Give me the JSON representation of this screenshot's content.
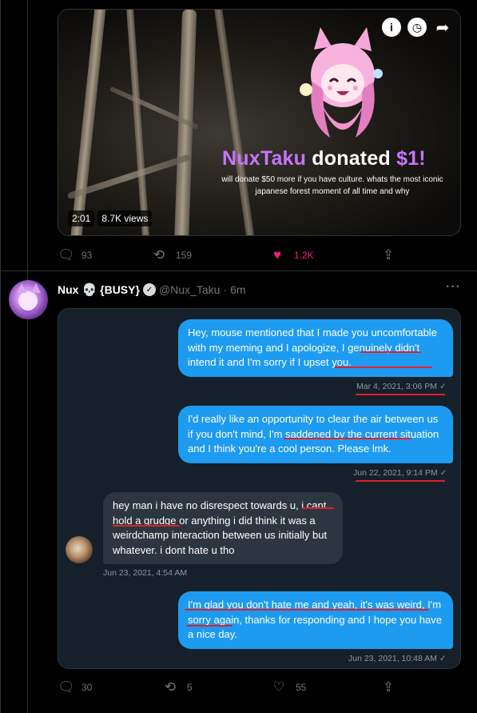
{
  "video": {
    "donation_name": "NuxTaku",
    "donation_word": "donated",
    "donation_amount": "$1!",
    "donation_message": "will donate $50 more if you have culture. whats the most iconic japanese forest moment of all time and why",
    "duration": "2:01",
    "views": "8.7K views",
    "icons": [
      "info-icon",
      "clock-icon",
      "share-arrow-icon"
    ]
  },
  "tweet1_actions": {
    "replies": "93",
    "retweets": "159",
    "likes": "1.2K",
    "like_color": "#f91880"
  },
  "tweet2": {
    "name": "Nux",
    "emoji": "💀",
    "busy": "{BUSY}",
    "handle": "@Nux_Taku",
    "dot": "·",
    "time": "6m",
    "more": "···"
  },
  "chat": {
    "messages": [
      {
        "direction": "out",
        "text": "Hey, mouse mentioned that I made you uncomfortable with my meming and I apologize, I genuinely didn't intend it and I'm sorry if I upset you.",
        "timestamp": "Mar 4, 2021, 3:06 PM"
      },
      {
        "direction": "out",
        "text": "I'd really like an opportunity to clear the air between us if you don't mind, I'm saddened by the current situation and I think you're a cool person. Please lmk.",
        "timestamp": "Jun 22, 2021, 9:14 PM"
      },
      {
        "direction": "in",
        "text": "hey man i have no disrespect towards u, i cant hold a grudge or anything i did think it was a weirdchamp interaction between us initially but whatever. i dont hate u tho",
        "timestamp": "Jun 23, 2021, 4:54 AM"
      },
      {
        "direction": "out",
        "text": "I'm glad you don't hate me and yeah, it's was weird, I'm sorry again, thanks for responding and  I hope you have a nice day.",
        "timestamp": "Jun 23, 2021, 10:48 AM"
      }
    ],
    "check": "✓",
    "out_color": "#1d9bf0",
    "in_color": "#2c3640",
    "underline_color": "#e0202a"
  },
  "tweet2_actions": {
    "replies": "30",
    "retweets": "5",
    "likes": "55"
  }
}
